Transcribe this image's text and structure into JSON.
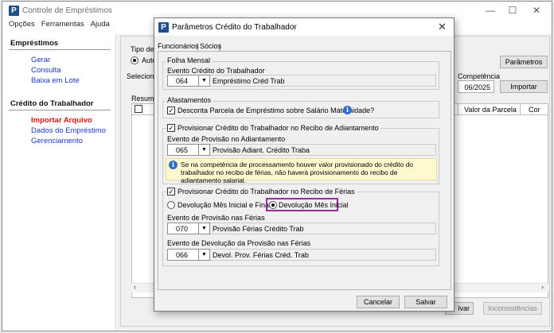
{
  "main": {
    "title": "Controle de Empréstimos",
    "menu": [
      "Opções",
      "Ferramentas",
      "Ajuda"
    ]
  },
  "sidebar": {
    "sections": [
      {
        "title": "Empréstimos",
        "links": [
          "Gerar",
          "Consulta",
          "Baixa em Lote"
        ]
      },
      {
        "title": "Crédito do Trabalhador",
        "links": [
          "Importar Arquivo",
          "Dados do Empréstimo",
          "Gerenciamento"
        ]
      }
    ]
  },
  "background": {
    "tipo_label": "Tipo de",
    "auto_label": "Auto",
    "selecione_label": "Selecione",
    "parametros_btn": "Parâmetros",
    "competencia_label": "Competência",
    "competencia_value": "06/2025",
    "importar_btn": "Importar",
    "resumo_label": "Resumo",
    "col_valor_parcela": "Valor da Parcela",
    "col_cor": "Cor",
    "salvar_partial": "lvar",
    "inconsistencias_btn": "Inconsistências"
  },
  "dialog": {
    "title": "Parâmetros Crédito do Trabalhador",
    "tabs": [
      "Funcionários",
      "Sócios"
    ],
    "folha_mensal": {
      "label": "Folha Mensal",
      "field_label": "Evento Crédito do Trabalhador",
      "code": "064",
      "desc": "Empréstimo Créd Trab"
    },
    "afastamentos": {
      "label": "Afastamentos",
      "check_label": "Desconta Parcela de Empréstimo sobre Salário Maternidade?"
    },
    "adiantamento": {
      "label": "Provisionar Crédito do Trabalhador no Recibo de Adiantamento",
      "field_label": "Evento de Provisão no Adiantamento",
      "code": "065",
      "desc": "Provisão Adiant. Crédito Traba",
      "note": "Se na competência de processamento houver valor provisionado do crédito do trabalhador no recibo de férias, não haverá provisionamento do recibo de adiantamento salarial."
    },
    "ferias": {
      "label": "Provisionar Crédito do Trabalhador no Recibo de Férias",
      "radio1": "Devolução Mês Inicial e Final",
      "radio2": "Devolução Mês Inicial",
      "field1_label": "Evento de Provisão nas Férias",
      "code1": "070",
      "desc1": "Provisão Férias Crédito Trab",
      "field2_label": "Evento de Devolução da Provisão nas Férias",
      "code2": "066",
      "desc2": "Devol. Prov. Férias Créd. Trab"
    },
    "cancel": "Cancelar",
    "save": "Salvar"
  },
  "colors": {
    "highlight": "#9b2a9c",
    "link": "#1a37c5",
    "active_link": "#d81313",
    "logo": "#1f4e8c"
  }
}
